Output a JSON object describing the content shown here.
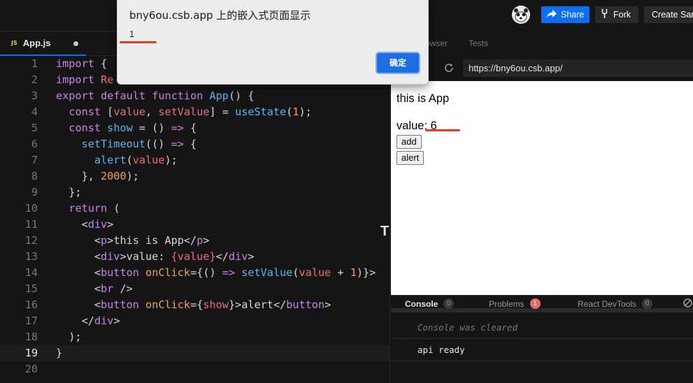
{
  "topbar": {
    "share_label": "Share",
    "fork_label": "Fork",
    "create_label": "Create Sandbox"
  },
  "editor": {
    "tab": {
      "icon": "JS",
      "filename": "App.js"
    },
    "current_line": 19,
    "line_numbers": [
      "1",
      "2",
      "3",
      "4",
      "5",
      "6",
      "7",
      "8",
      "9",
      "10",
      "11",
      "12",
      "13",
      "14",
      "15",
      "16",
      "17",
      "18",
      "19",
      "20"
    ]
  },
  "preview": {
    "tabs": [
      "Browser",
      "Tests"
    ],
    "url": "https://bny6ou.csb.app/",
    "app_text": "this is App",
    "value_text": "value: 6",
    "add_label": "add",
    "alert_label": "alert"
  },
  "console": {
    "tabs": [
      {
        "label": "Console",
        "count": "0"
      },
      {
        "label": "Problems",
        "count": "1"
      },
      {
        "label": "React DevTools",
        "count": "0"
      }
    ],
    "lines": [
      "Console was cleared",
      "api ready"
    ]
  },
  "dialog": {
    "title": "bny6ou.csb.app 上的嵌入式页面显示",
    "message": "1",
    "ok_label": "确定"
  },
  "colors": {
    "accent": "#0971f1",
    "annotation_red": "#e8391d",
    "problem_badge": "#e86a6a"
  },
  "icons": [
    "share-icon",
    "fork-icon",
    "reload-icon",
    "clear-console-icon",
    "js-file-icon",
    "unsaved-dot-icon",
    "avatar"
  ],
  "stray_char": "T"
}
